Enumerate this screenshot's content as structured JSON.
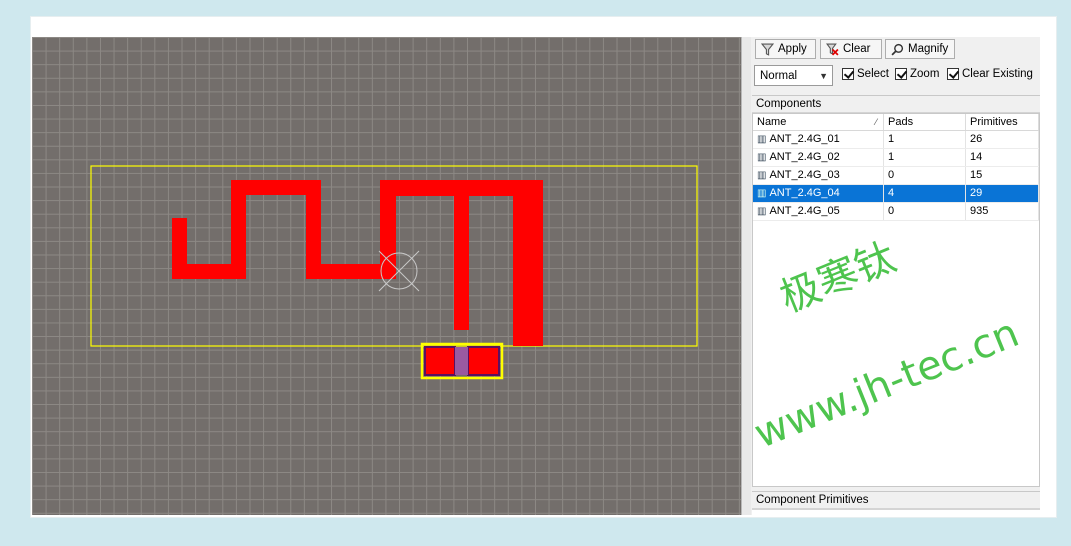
{
  "toolbar": {
    "apply_label": "Apply",
    "clear_label": "Clear",
    "magnify_label": "Magnify",
    "mode_value": "Normal",
    "select_label": "Select",
    "zoom_label": "Zoom",
    "clear_existing_label": "Clear Existing"
  },
  "components": {
    "title": "Components",
    "columns": [
      "Name",
      "Pads",
      "Primitives"
    ],
    "rows": [
      {
        "name": "ANT_2.4G_01",
        "pads": "1",
        "primitives": "26"
      },
      {
        "name": "ANT_2.4G_02",
        "pads": "1",
        "primitives": "14"
      },
      {
        "name": "ANT_2.4G_03",
        "pads": "0",
        "primitives": "15"
      },
      {
        "name": "ANT_2.4G_04",
        "pads": "4",
        "primitives": "29"
      },
      {
        "name": "ANT_2.4G_05",
        "pads": "0",
        "primitives": "935"
      }
    ],
    "selected_row": "ANT_2.4G_04"
  },
  "primitives": {
    "title": "Component Primitives"
  },
  "watermark": {
    "chinese": "极寒钛",
    "url": "www.jh-tec.cn"
  },
  "colors": {
    "canvas": "#736e6b",
    "trace": "#ff0000",
    "outline": "#ffff00",
    "selection": "#0a74d6",
    "watermark": "#3fbf3f"
  }
}
